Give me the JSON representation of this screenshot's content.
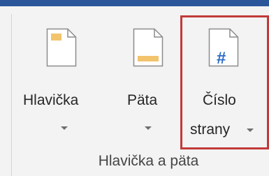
{
  "ribbon": {
    "group_label": "Hlavička a päta",
    "buttons": {
      "header": {
        "label": "Hlavička"
      },
      "footer": {
        "label": "Päta"
      },
      "page_number": {
        "label_line1": "Číslo",
        "label_line2": "strany",
        "icon_glyph": "#"
      }
    }
  },
  "colors": {
    "accent_bar": "#2b579a",
    "highlight": "#c13a3a",
    "bar_fill": "#f2c46d",
    "hash_blue": "#2b6cc4"
  },
  "icons": [
    "header-doc-icon",
    "footer-doc-icon",
    "page-number-doc-icon",
    "dropdown-arrow-icon"
  ]
}
